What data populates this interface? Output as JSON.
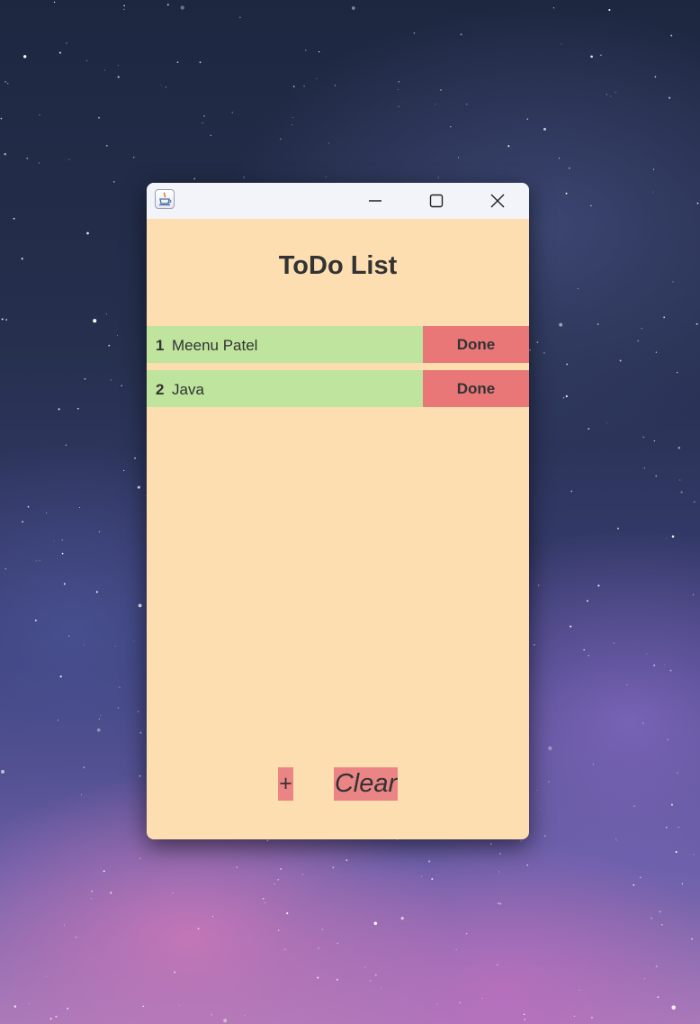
{
  "window": {
    "title": "ToDo List",
    "background_color": "#fddeb0"
  },
  "titlebar": {
    "icon": "java-cup-icon",
    "controls": [
      "minimize-icon",
      "maximize-icon",
      "close-icon"
    ]
  },
  "tasks": [
    {
      "number": "1",
      "text": "Meenu Patel",
      "done_label": "Done"
    },
    {
      "number": "2",
      "text": "Java",
      "done_label": "Done"
    }
  ],
  "footer": {
    "add_label": "+",
    "clear_label": "Clear"
  },
  "colors": {
    "task_bg": "#bfe49d",
    "done_bg": "#ea7778",
    "footer_button_bg": "#ea8485",
    "text": "#333333"
  }
}
